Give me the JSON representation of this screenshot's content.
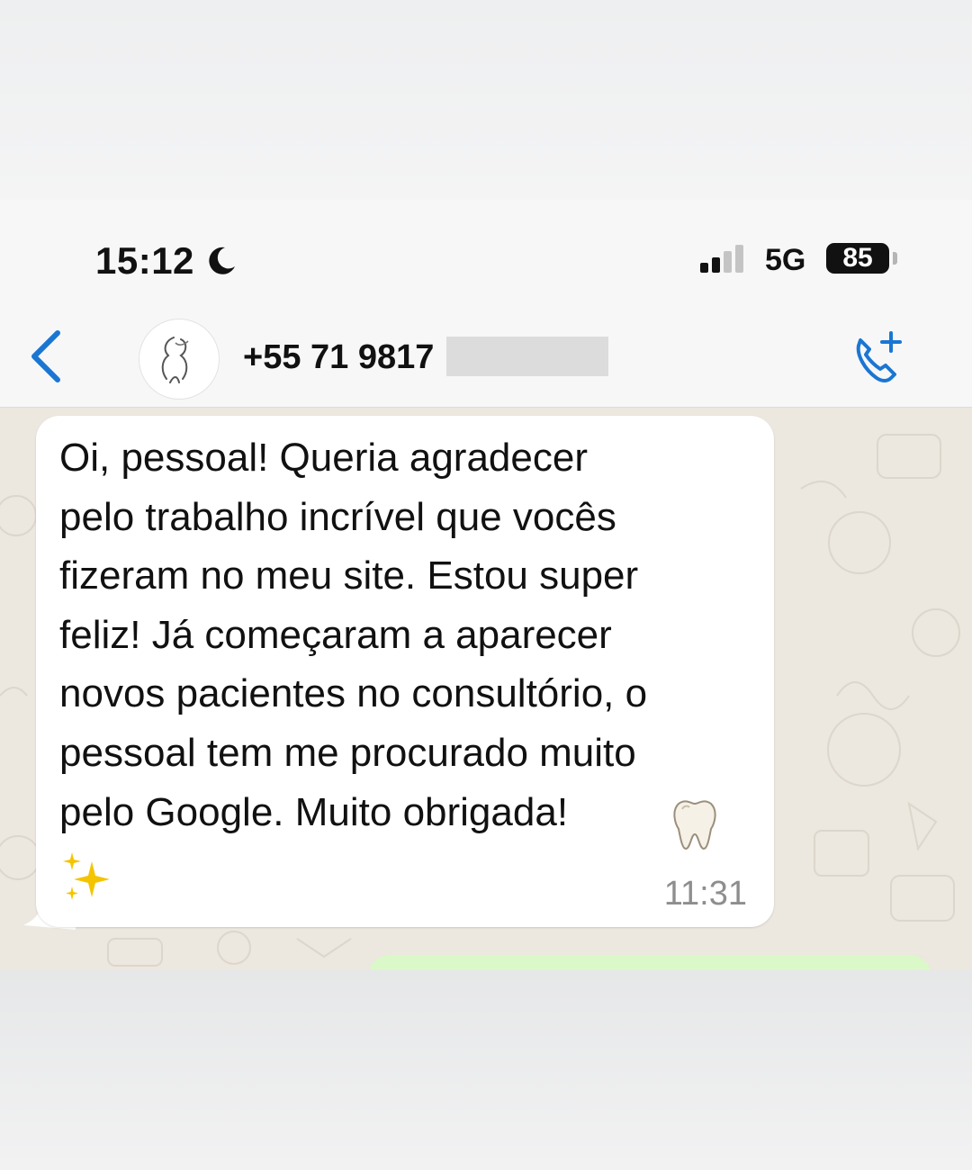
{
  "status_bar": {
    "time": "15:12",
    "network": "5G",
    "battery": "85"
  },
  "header": {
    "contact_number": "+55 71 9817"
  },
  "message": {
    "text": "Oi, pessoal! Queria agradecer\npelo trabalho incrível que vocês\nfizeram no meu site. Estou super\nfeliz! Já começaram a aparecer\nnovos pacientes no consultório, o\npessoal tem me procurado muito\npelo Google. Muito obrigada!",
    "timestamp": "11:31",
    "emojis": [
      "tooth-icon",
      "sparkles-icon"
    ]
  },
  "colors": {
    "accent_blue": "#1a76d2",
    "chat_background": "#ece7df",
    "incoming_bubble": "#ffffff",
    "outgoing_bubble": "#daf8c8"
  }
}
